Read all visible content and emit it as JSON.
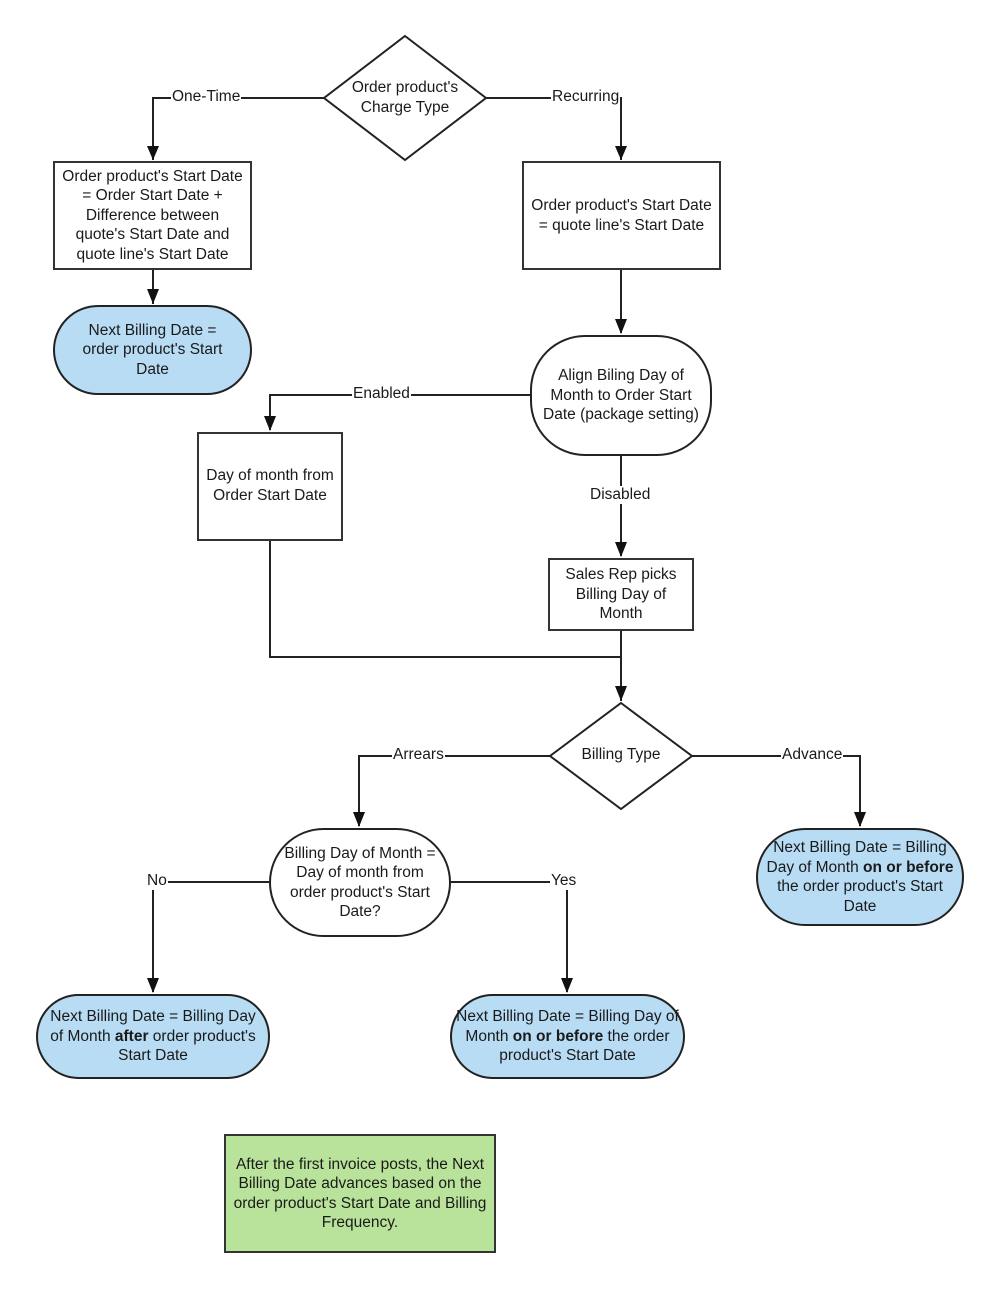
{
  "colors": {
    "terminal_fill": "#b8dcf4",
    "note_fill": "#b9e39b",
    "line": "#222222"
  },
  "nodes": {
    "charge_type": "Order product's Charge Type",
    "one_time_start": "Order product's Start Date = Order Start Date + Difference between quote's Start Date and quote line's Start Date",
    "one_time_next": "Next Billing Date = order product's Start Date",
    "recurring_start": "Order product's Start Date = quote line's Start Date",
    "align_billing": "Align Biling Day of Month to Order Start Date (package setting)",
    "day_from_order": "Day of month from Order Start Date",
    "sales_rep": "Sales Rep picks Billing Day of Month",
    "billing_type": "Billing Type",
    "day_match": "Billing Day of Month = Day of month from order product's Start Date?",
    "arrears_no": {
      "pre": "Next Billing Date = Billing Day of Month ",
      "bold": "after",
      "post": " order product's Start Date"
    },
    "arrears_yes": {
      "pre": "Next Billing Date = Billing Day of Month ",
      "bold": "on or before",
      "post": " the order product's Start Date"
    },
    "advance": {
      "pre": "Next Billing Date = Billing Day of Month ",
      "bold": "on or before",
      "post": " the order product's Start Date"
    },
    "note": "After the first invoice posts, the Next Billing Date advances based on the order product's Start Date and Billing Frequency."
  },
  "edges": {
    "one_time": "One-Time",
    "recurring": "Recurring",
    "enabled": "Enabled",
    "disabled": "Disabled",
    "arrears": "Arrears",
    "advance": "Advance",
    "no": "No",
    "yes": "Yes"
  }
}
